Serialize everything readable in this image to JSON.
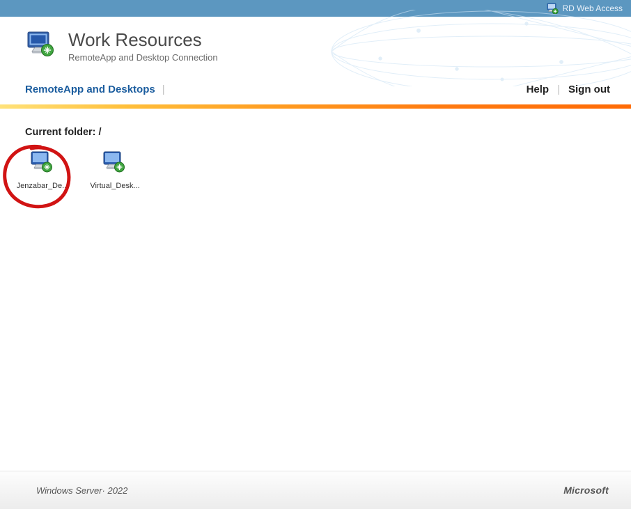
{
  "topbar": {
    "label": "RD Web Access"
  },
  "header": {
    "title": "Work Resources",
    "subtitle": "RemoteApp and Desktop Connection"
  },
  "nav": {
    "active": "RemoteApp and Desktops",
    "help": "Help",
    "signout": "Sign out"
  },
  "content": {
    "folder_label": "Current folder: /",
    "apps": [
      {
        "label": "Jenzabar_De...",
        "icon": "remote-desktop-icon"
      },
      {
        "label": "Virtual_Desk...",
        "icon": "remote-desktop-icon"
      }
    ]
  },
  "footer": {
    "left": "Windows Server· 2022",
    "right": "Microsoft"
  }
}
